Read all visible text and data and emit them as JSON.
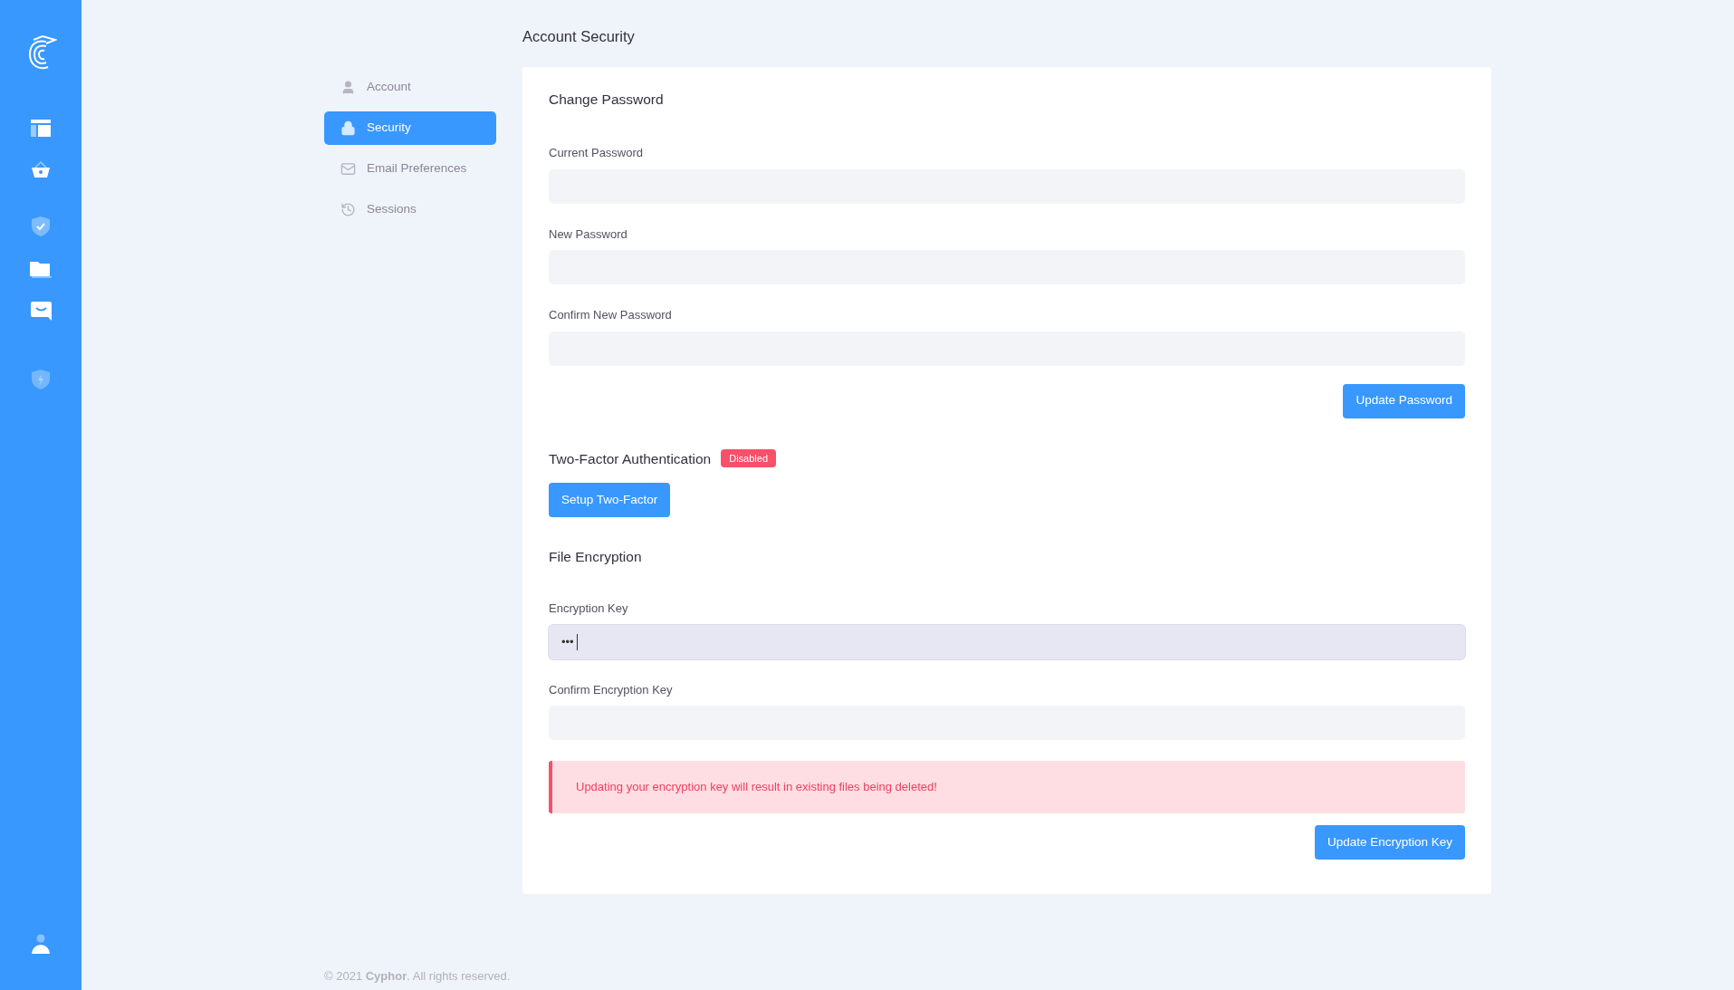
{
  "page_title": "Account Security",
  "settings_nav": [
    {
      "label": "Account",
      "selected": false
    },
    {
      "label": "Security",
      "selected": true
    },
    {
      "label": "Email Preferences",
      "selected": false
    },
    {
      "label": "Sessions",
      "selected": false
    }
  ],
  "change_password": {
    "title": "Change Password",
    "fields": [
      {
        "label": "Current Password"
      },
      {
        "label": "New Password"
      },
      {
        "label": "Confirm New Password"
      }
    ],
    "button": "Update Password"
  },
  "two_factor": {
    "title": "Two-Factor Authentication",
    "status": "Disabled",
    "button": "Setup Two-Factor"
  },
  "file_encryption": {
    "title": "File Encryption",
    "fields": [
      {
        "label": "Encryption Key",
        "value": "•••",
        "focused": true
      },
      {
        "label": "Confirm Encryption Key",
        "focused": false
      }
    ],
    "warning": "Updating your encryption key will result in existing files being deleted!",
    "button": "Update Encryption Key"
  },
  "footer": "© 2021 **Cyphor**. All rights reserved."
}
